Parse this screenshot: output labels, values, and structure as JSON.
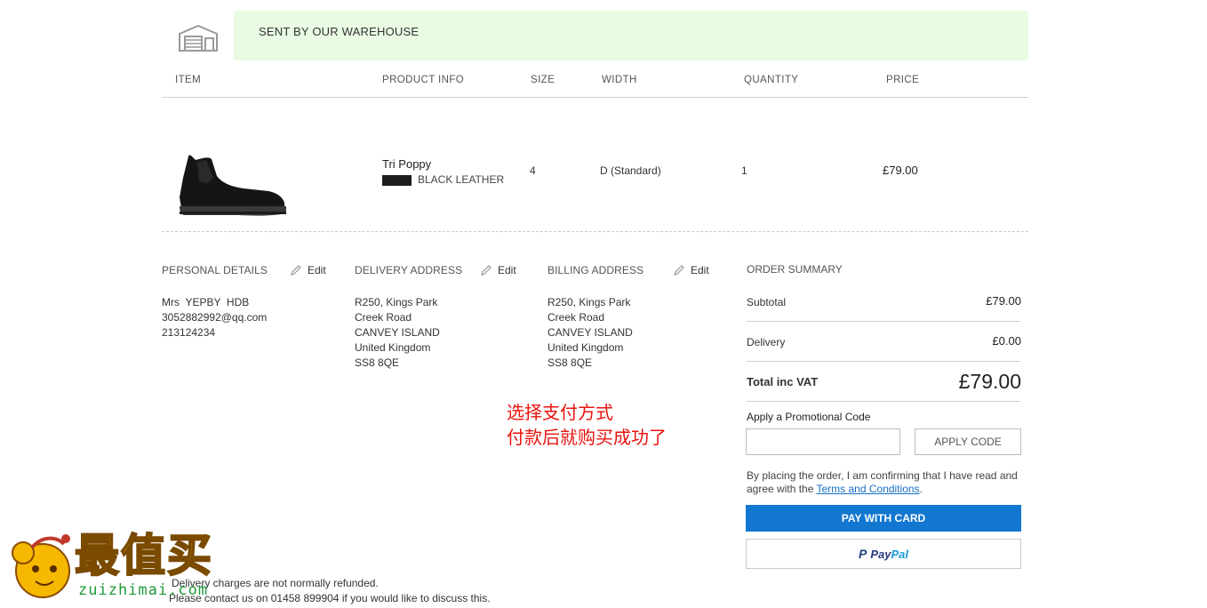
{
  "warehouse": {
    "banner_text": "SENT BY OUR WAREHOUSE",
    "icon": "warehouse-icon"
  },
  "table": {
    "headers": [
      "ITEM",
      "PRODUCT INFO",
      "SIZE",
      "WIDTH",
      "QUANTITY",
      "PRICE"
    ],
    "item": {
      "name": "Tri Poppy",
      "color_swatch": "#1d1d1d",
      "color": "BLACK LEATHER",
      "size": "4",
      "width": "D (Standard)",
      "quantity": "1",
      "price": "£79.00"
    }
  },
  "personal": {
    "title": "PERSONAL DETAILS",
    "edit": "Edit",
    "lines": [
      "Mrs  YEPBY  HDB",
      "3052882992@qq.com",
      "213124234"
    ]
  },
  "delivery": {
    "title": "DELIVERY ADDRESS",
    "edit": "Edit",
    "lines": [
      "R250, Kings Park",
      "Creek Road",
      "CANVEY ISLAND",
      "United Kingdom",
      "SS8 8QE"
    ]
  },
  "billing": {
    "title": "BILLING ADDRESS",
    "edit": "Edit",
    "lines": [
      "R250, Kings Park",
      "Creek Road",
      "CANVEY ISLAND",
      "United Kingdom",
      "SS8 8QE"
    ]
  },
  "summary": {
    "title": "ORDER SUMMARY",
    "subtotal_label": "Subtotal",
    "subtotal_value": "£79.00",
    "delivery_label": "Delivery",
    "delivery_value": "£0.00",
    "total_label": "Total inc VAT",
    "total_value": "£79.00",
    "promo_title": "Apply a Promotional Code",
    "promo_placeholder": "",
    "promo_button": "APPLY CODE",
    "terms_prefix": "By placing the order, I am confirming that I have read and agree with the ",
    "terms_link": "Terms and Conditions",
    "terms_suffix": ".",
    "pay_card": "PAY WITH CARD",
    "paypal_pay": "Pay",
    "paypal_pal": "Pal"
  },
  "annotation": {
    "line1": "选择支付方式",
    "line2": "付款后就购买成功了"
  },
  "footer": {
    "note1": "Delivery charges are not normally refunded.",
    "note2": "Please contact us on 01458 899904 if you would like to discuss this."
  },
  "watermark": {
    "title": "最值买",
    "url": "zuizhimai.com"
  },
  "colors": {
    "banner_bg": "#e9fbe3",
    "pay_button": "#1277d0",
    "link": "#1570c4",
    "annotation": "#e8140f"
  }
}
